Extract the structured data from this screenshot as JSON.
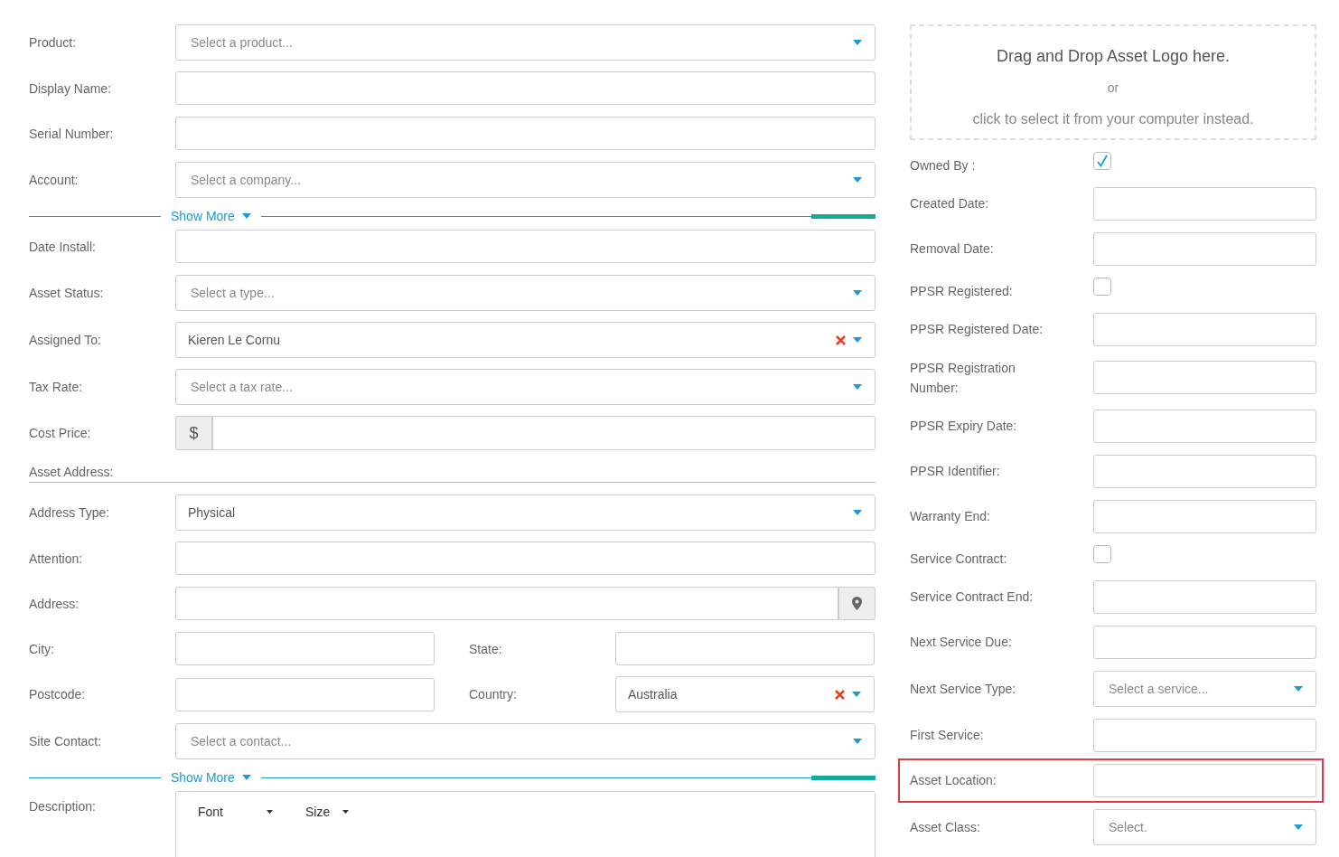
{
  "left": {
    "rows": [
      {
        "kind": "select",
        "label": "Product:",
        "placeholder": "Select a product...",
        "clearable": false
      },
      {
        "kind": "input",
        "label": "Display Name:"
      },
      {
        "kind": "input",
        "label": "Serial Number:"
      },
      {
        "kind": "select",
        "label": "Account:",
        "placeholder": "Select a company...",
        "clearable": false
      },
      {
        "kind": "show-more",
        "label": "Show More"
      },
      {
        "kind": "input",
        "label": "Date Install:"
      },
      {
        "kind": "select",
        "label": "Asset Status:",
        "placeholder": "Select a type...",
        "clearable": false
      },
      {
        "kind": "select",
        "label": "Assigned To:",
        "value": "Kieren Le Cornu",
        "clearable": true
      },
      {
        "kind": "select",
        "label": "Tax Rate:",
        "placeholder": "Select a tax rate...",
        "clearable": false
      },
      {
        "kind": "money",
        "label": "Cost Price:",
        "prefix": "$"
      },
      {
        "kind": "section",
        "label": "Asset Address:"
      },
      {
        "kind": "select",
        "label": "Address Type:",
        "value": "Physical",
        "clearable": false
      },
      {
        "kind": "input",
        "label": "Attention:"
      },
      {
        "kind": "address",
        "label": "Address:"
      },
      {
        "kind": "pair",
        "fields": [
          {
            "kind": "input",
            "label": "City:"
          },
          {
            "kind": "input",
            "label": "State:"
          }
        ]
      },
      {
        "kind": "pair",
        "fields": [
          {
            "kind": "input",
            "label": "Postcode:"
          },
          {
            "kind": "select",
            "label": "Country:",
            "value": "Australia",
            "clearable": true
          }
        ]
      },
      {
        "kind": "select",
        "label": "Site Contact:",
        "placeholder": "Select a contact...",
        "clearable": false
      },
      {
        "kind": "show-more",
        "label": "Show More"
      },
      {
        "kind": "editor",
        "label": "Description:",
        "toolbar": [
          "Font",
          "Size"
        ]
      }
    ]
  },
  "right": {
    "dropzone": {
      "title": "Drag and Drop Asset Logo here.",
      "or": "or",
      "hint": "click to select it from your computer instead."
    },
    "rows": [
      {
        "kind": "checkbox",
        "label": "Owned By :",
        "checked": true,
        "highlighted": false
      },
      {
        "kind": "input",
        "label": "Created Date:",
        "highlighted": false
      },
      {
        "kind": "input",
        "label": "Removal Date:",
        "highlighted": false
      },
      {
        "kind": "checkbox",
        "label": "PPSR Registered:",
        "checked": false,
        "highlighted": false
      },
      {
        "kind": "input",
        "label": "PPSR Registered Date:",
        "highlighted": false
      },
      {
        "kind": "input",
        "label": "PPSR Registration Number:",
        "highlighted": false
      },
      {
        "kind": "input",
        "label": "PPSR Expiry Date:",
        "highlighted": false
      },
      {
        "kind": "input",
        "label": "PPSR Identifier:",
        "highlighted": false
      },
      {
        "kind": "input",
        "label": "Warranty End:",
        "highlighted": false
      },
      {
        "kind": "checkbox",
        "label": "Service Contract:",
        "checked": false,
        "highlighted": false
      },
      {
        "kind": "input",
        "label": "Service Contract End:",
        "highlighted": false
      },
      {
        "kind": "input",
        "label": "Next Service Due:",
        "highlighted": false
      },
      {
        "kind": "select",
        "label": "Next Service Type:",
        "placeholder": "Select a service...",
        "clearable": false,
        "highlighted": false
      },
      {
        "kind": "input",
        "label": "First Service:",
        "highlighted": false
      },
      {
        "kind": "input",
        "label": "Asset Location:",
        "highlighted": true
      },
      {
        "kind": "select",
        "label": "Asset Class:",
        "placeholder": "Select.",
        "clearable": false,
        "highlighted": false
      }
    ]
  }
}
